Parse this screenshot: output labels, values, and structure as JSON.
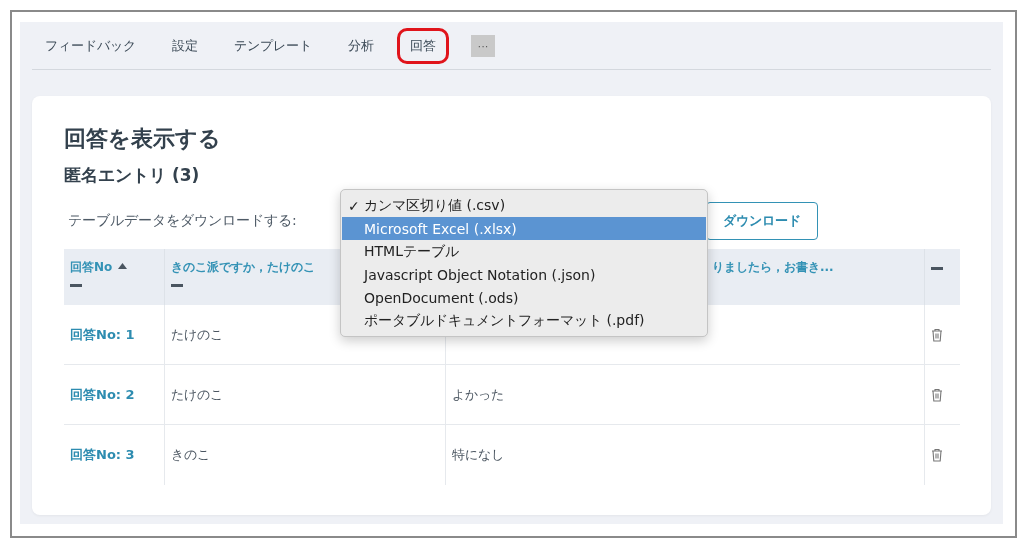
{
  "tabs": [
    {
      "label": "フィードバック",
      "selected": false
    },
    {
      "label": "設定",
      "selected": false
    },
    {
      "label": "テンプレート",
      "selected": false
    },
    {
      "label": "分析",
      "selected": false
    },
    {
      "label": "回答",
      "selected": true
    }
  ],
  "more_button": "···",
  "card": {
    "title": "回答を表示する",
    "subtitle": "匿名エントリ (3)",
    "download_label": "テーブルデータをダウンロードする:",
    "download_button": "ダウンロード",
    "format_menu": [
      {
        "label": "カンマ区切り値 (.csv)",
        "checked": true,
        "selected": false
      },
      {
        "label": "Microsoft Excel (.xlsx)",
        "checked": false,
        "selected": true
      },
      {
        "label": "HTMLテーブル",
        "checked": false,
        "selected": false
      },
      {
        "label": "Javascript Object Notation (.json)",
        "checked": false,
        "selected": false
      },
      {
        "label": "OpenDocument (.ods)",
        "checked": false,
        "selected": false
      },
      {
        "label": "ポータブルドキュメントフォーマット (.pdf)",
        "checked": false,
        "selected": false
      }
    ],
    "check_mark": "✓",
    "table": {
      "columns": [
        {
          "label": "回答No",
          "sorted": true
        },
        {
          "label": "きのこ派ですか，たけのこ"
        },
        {
          "label": "りましたら，お書き..."
        }
      ],
      "rows": [
        {
          "number": "回答No: 1",
          "answer": "たけのこ"
        },
        {
          "number": "回答No: 2",
          "answer": "たけのこ",
          "comment": "よかった"
        },
        {
          "number": "回答No: 3",
          "answer": "きのこ",
          "comment": "特になし"
        }
      ]
    }
  }
}
